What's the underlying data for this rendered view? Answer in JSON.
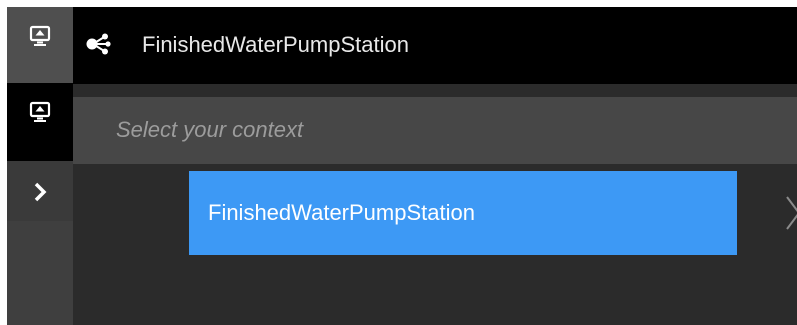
{
  "header": {
    "title": "FinishedWaterPumpStation",
    "icon": "network-nodes-icon"
  },
  "sidebar": {
    "items": [
      {
        "icon": "monitor-icon",
        "state": "default"
      },
      {
        "icon": "monitor-icon",
        "state": "active"
      },
      {
        "icon": "chevron-right-icon",
        "state": "default"
      }
    ]
  },
  "context": {
    "placeholder": "Select your context",
    "items": [
      {
        "label": "FinishedWaterPumpStation",
        "selected": true
      }
    ],
    "next_icon": "chevron-right-icon"
  },
  "colors": {
    "header_bg": "#000000",
    "panel_bg": "#2b2b2b",
    "context_bar_bg": "#474747",
    "selected_item_bg": "#3d99f5",
    "text_primary": "#e8e8e8",
    "text_muted": "#9c9c9c"
  }
}
